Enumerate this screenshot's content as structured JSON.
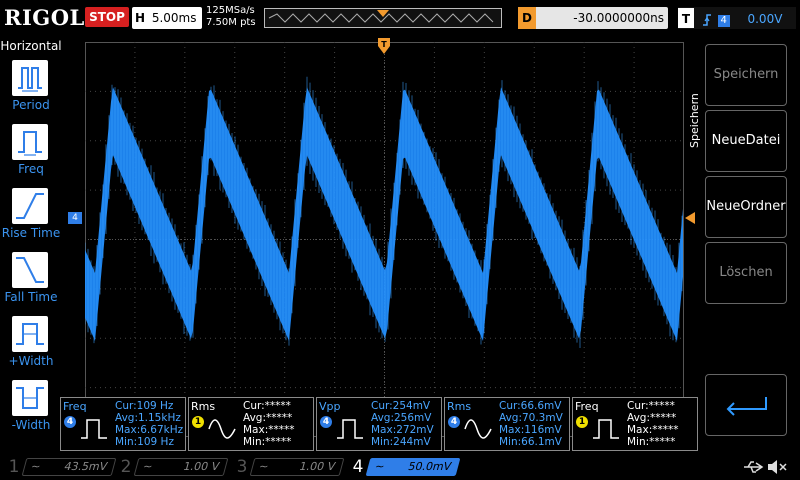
{
  "topbar": {
    "logo": "RIGOL",
    "run_state": "STOP",
    "timebase_label": "H",
    "timebase_value": "5.00ms",
    "sample_rate": "125MSa/s",
    "memory_depth": "7.50M pts",
    "delay_label": "D",
    "delay_value": "-30.0000000ns",
    "trigger_label": "T",
    "trigger_channel": "4",
    "trigger_level": "0.00V"
  },
  "left_menu": {
    "title": "Horizontal",
    "items": [
      {
        "label": "Period",
        "icon": "period-icon"
      },
      {
        "label": "Freq",
        "icon": "frequency-icon"
      },
      {
        "label": "Rise Time",
        "icon": "rise-time-icon"
      },
      {
        "label": "Fall Time",
        "icon": "fall-time-icon"
      },
      {
        "label": "+Width",
        "icon": "positive-width-icon"
      },
      {
        "label": "-Width",
        "icon": "negative-width-icon"
      }
    ]
  },
  "right_menu": {
    "title": "Speichern",
    "buttons": [
      {
        "label": "Speichern",
        "enabled": false
      },
      {
        "label": "NeueDatei",
        "enabled": true
      },
      {
        "label": "NeueOrdner",
        "enabled": true
      },
      {
        "label": "Löschen",
        "enabled": false
      }
    ]
  },
  "measurements": [
    {
      "name": "Freq",
      "channel": "4",
      "channel_color": "#2f7ee8",
      "icon": "pulse-icon",
      "rows": [
        [
          "Cur:",
          "109 Hz"
        ],
        [
          "Avg:",
          "1.15kHz"
        ],
        [
          "Max:",
          "6.67kHz"
        ],
        [
          "Min:",
          "109 Hz"
        ]
      ]
    },
    {
      "name": "Rms",
      "channel": "1",
      "channel_color": "#f0e000",
      "icon": "sine-icon",
      "rows": [
        [
          "Cur:",
          "*****"
        ],
        [
          "Avg:",
          "*****"
        ],
        [
          "Max:",
          "*****"
        ],
        [
          "Min:",
          "*****"
        ]
      ]
    },
    {
      "name": "Vpp",
      "channel": "4",
      "channel_color": "#2f7ee8",
      "icon": "pulse-icon",
      "rows": [
        [
          "Cur:",
          "254mV"
        ],
        [
          "Avg:",
          "256mV"
        ],
        [
          "Max:",
          "272mV"
        ],
        [
          "Min:",
          "244mV"
        ]
      ]
    },
    {
      "name": "Rms",
      "channel": "4",
      "channel_color": "#2f7ee8",
      "icon": "sine-icon",
      "rows": [
        [
          "Cur:",
          "66.6mV"
        ],
        [
          "Avg:",
          "70.3mV"
        ],
        [
          "Max:",
          "116mV"
        ],
        [
          "Min:",
          "66.1mV"
        ]
      ]
    },
    {
      "name": "Freq",
      "channel": "1",
      "channel_color": "#f0e000",
      "icon": "pulse-icon",
      "rows": [
        [
          "Cur:",
          "*****"
        ],
        [
          "Avg:",
          "*****"
        ],
        [
          "Max:",
          "*****"
        ],
        [
          "Min:",
          "*****"
        ]
      ]
    }
  ],
  "channels": [
    {
      "num": "1",
      "coupling": "~",
      "value": "43.5mV",
      "active": false
    },
    {
      "num": "2",
      "coupling": "~",
      "value": "1.00 V",
      "active": false
    },
    {
      "num": "3",
      "coupling": "~",
      "value": "1.00 V",
      "active": false
    },
    {
      "num": "4",
      "coupling": "~",
      "value": "50.0mV",
      "active": true
    }
  ],
  "colors": {
    "ch1": "#f0e000",
    "ch2": "#00e0e0",
    "ch3": "#e000e0",
    "ch4": "#2f7ee8",
    "accent": "#3b94f0",
    "trigger": "#f29a2e",
    "stop": "#d62020"
  },
  "waveform": {
    "channel": "4",
    "shape": "sawtooth",
    "color": "#1e8cff"
  }
}
